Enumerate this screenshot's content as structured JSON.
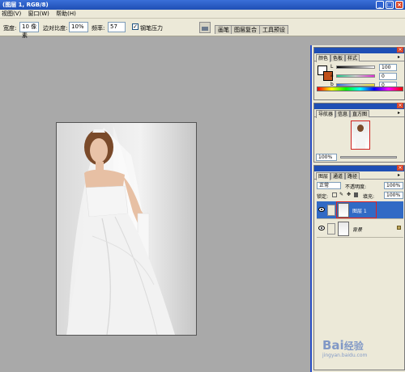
{
  "window": {
    "title": "(图层 1, RGB/8)"
  },
  "menu": {
    "items": [
      "视图(V)",
      "窗口(W)",
      "帮助(H)"
    ]
  },
  "options": {
    "width_label": "宽度:",
    "width_value": "10 像素",
    "contrast_label": "边对比度:",
    "contrast_value": "10%",
    "frequency_label": "频率:",
    "frequency_value": "57",
    "pen_pressure_label": "钢笔压力",
    "pen_pressure_checked": true,
    "well_tabs": [
      "画笔",
      "图层复合",
      "工具预设"
    ]
  },
  "color_panel": {
    "tabs": [
      "颜色",
      "色板",
      "样式"
    ],
    "foreground": "#ffffff",
    "background": "#c0501a",
    "channels": [
      {
        "letter": "L",
        "value": "100"
      },
      {
        "letter": "a",
        "value": "0"
      },
      {
        "letter": "b",
        "value": "0"
      }
    ]
  },
  "navigator_panel": {
    "tabs": [
      "导航器",
      "信息",
      "直方图"
    ],
    "zoom": "100%"
  },
  "layers_panel": {
    "tabs": [
      "图层",
      "通道",
      "路径"
    ],
    "blend_mode": "正常",
    "opacity_label": "不透明度:",
    "opacity_value": "100%",
    "lock_label": "锁定:",
    "fill_label": "填充:",
    "fill_value": "100%",
    "layers": [
      {
        "name": "图层 1",
        "selected": true,
        "locked": false
      },
      {
        "name": "背景",
        "selected": false,
        "locked": true
      }
    ]
  },
  "watermark": {
    "brand": "Bai",
    "suffix": "经验",
    "domain": "jingyan.baidu.com"
  }
}
